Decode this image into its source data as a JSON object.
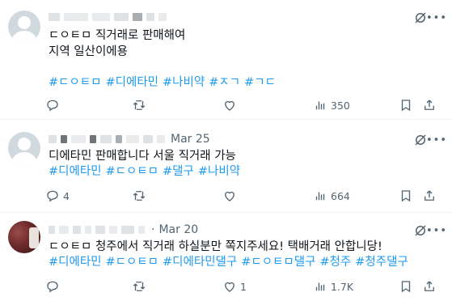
{
  "tweets": [
    {
      "date": "",
      "lines": [
        "ㄷㅇㅌㅁ 직거래로 판매해여",
        "지역 일산이에용"
      ],
      "hashtags": [
        "#ㄷㅇㅌㅁ",
        "#디에타민",
        "#나비약",
        "#ㅈㄱ",
        "#ㄱㄷ"
      ],
      "counts": {
        "reply": "",
        "retweet": "",
        "like": "",
        "views": "350"
      }
    },
    {
      "date": "Mar 25",
      "lines": [
        "디에타민 판매합니다 서울 직거래 가능"
      ],
      "hashtags": [
        "#디에타민",
        "#ㄷㅇㅌㅁ",
        "#댈구",
        "#나비약"
      ],
      "counts": {
        "reply": "4",
        "retweet": "",
        "like": "",
        "views": "664"
      }
    },
    {
      "date": "Mar 20",
      "lines": [
        "ㄷㅇㅌㅁ 청주에서 직거래 하실분만 쪽지주세요! 택배거래 안합니당!"
      ],
      "hashtags": [
        "#디에타민",
        "#ㄷㅇㅌㅁ",
        "#디에타민댈구",
        "#ㄷㅇㅌㅁ댈구",
        "#청주",
        "#청주댈구"
      ],
      "counts": {
        "reply": "",
        "retweet": "",
        "like": "1",
        "views": "1.7K"
      }
    }
  ],
  "icons": {
    "grok": "grok-slash-icon",
    "more": "more-dots-icon",
    "reply": "reply-icon",
    "retweet": "retweet-icon",
    "like": "like-icon",
    "views": "views-icon",
    "bookmark": "bookmark-icon",
    "share": "share-icon"
  },
  "colors": {
    "link": "#1d9bf0",
    "muted": "#536471",
    "text": "#0f1419"
  }
}
